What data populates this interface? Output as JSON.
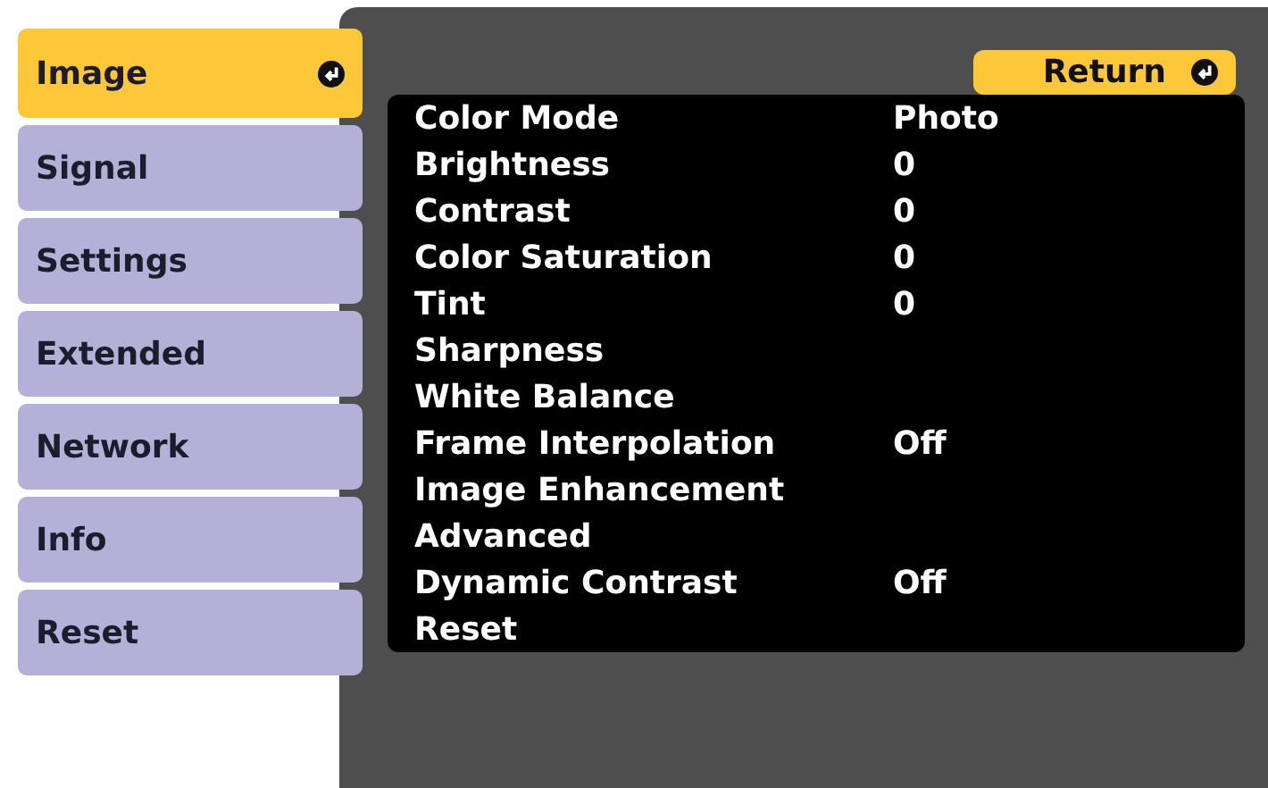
{
  "tabs": [
    {
      "label": "Image",
      "selected": true
    },
    {
      "label": "Signal",
      "selected": false
    },
    {
      "label": "Settings",
      "selected": false
    },
    {
      "label": "Extended",
      "selected": false
    },
    {
      "label": "Network",
      "selected": false
    },
    {
      "label": "Info",
      "selected": false
    },
    {
      "label": "Reset",
      "selected": false
    }
  ],
  "return_button": {
    "label": "Return"
  },
  "menu": [
    {
      "label": "Color Mode",
      "value": "Photo"
    },
    {
      "label": "Brightness",
      "value": "0"
    },
    {
      "label": "Contrast",
      "value": "0"
    },
    {
      "label": "Color Saturation",
      "value": "0"
    },
    {
      "label": "Tint",
      "value": "0"
    },
    {
      "label": "Sharpness"
    },
    {
      "label": "White Balance"
    },
    {
      "label": "Frame Interpolation",
      "value": "Off"
    },
    {
      "label": "Image Enhancement"
    },
    {
      "label": "Advanced"
    },
    {
      "label": "Dynamic Contrast",
      "value": "Off"
    },
    {
      "label": "Reset"
    }
  ]
}
